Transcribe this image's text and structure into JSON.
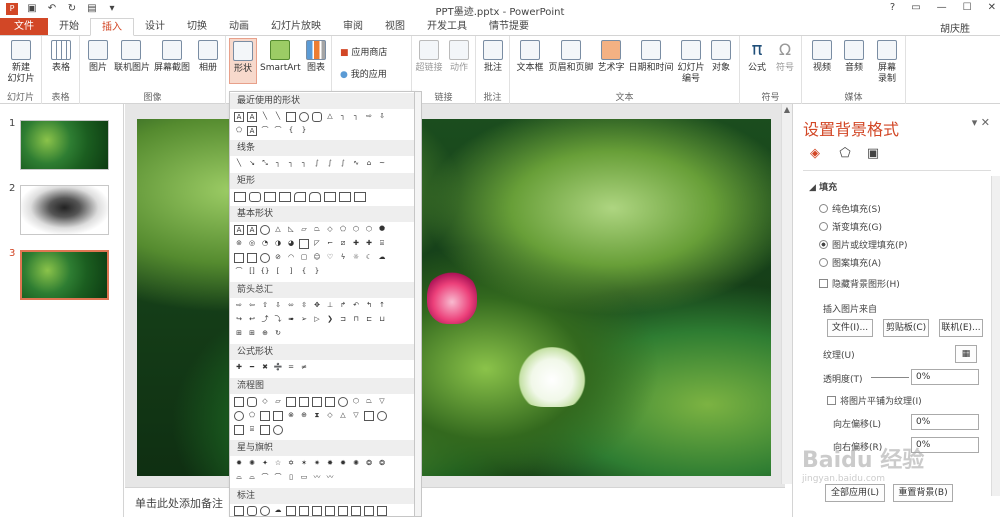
{
  "app": {
    "title": "PPT墨迹.pptx - PowerPoint",
    "user": "胡庆胜"
  },
  "tabs": [
    "文件",
    "开始",
    "插入",
    "设计",
    "切换",
    "动画",
    "幻灯片放映",
    "审阅",
    "视图",
    "开发工具",
    "情节提要"
  ],
  "ribbon": {
    "slides": {
      "label": "幻灯片",
      "new_slide": "新建\n幻灯片"
    },
    "tables": {
      "label": "表格",
      "table": "表格"
    },
    "images": {
      "label": "图像",
      "picture": "图片",
      "online_pictures": "联机图片",
      "screenshot": "屏幕截图",
      "album": "相册"
    },
    "illustrations": {
      "shapes": "形状",
      "smartart": "SmartArt",
      "chart": "图表"
    },
    "apps": {
      "store": "应用商店",
      "my_apps": "我的应用"
    },
    "links": {
      "label": "链接",
      "hyperlink": "超链接",
      "action": "动作"
    },
    "comments": {
      "label": "批注",
      "comment": "批注"
    },
    "text": {
      "label": "文本",
      "textbox": "文本框",
      "header_footer": "页眉和页脚",
      "wordart": "艺术字",
      "datetime": "日期和时间",
      "slide_number": "幻灯片\n编号",
      "object": "对象"
    },
    "symbols": {
      "label": "符号",
      "equation": "公式",
      "symbol": "符号"
    },
    "media": {
      "label": "媒体",
      "video": "视频",
      "audio": "音频",
      "screen_record": "屏幕\n录制"
    }
  },
  "thumbnails": [
    {
      "num": "1"
    },
    {
      "num": "2"
    },
    {
      "num": "3"
    }
  ],
  "notes_placeholder": "单击此处添加备注",
  "shapes_menu": {
    "sections": [
      "最近使用的形状",
      "线条",
      "矩形",
      "基本形状",
      "箭头总汇",
      "公式形状",
      "流程图",
      "星与旗帜",
      "标注"
    ]
  },
  "panel": {
    "title": "设置背景格式",
    "fill_header": "填充",
    "options": [
      "纯色填充(S)",
      "渐变填充(G)",
      "图片或纹理填充(P)",
      "图案填充(A)"
    ],
    "hide_bg": "隐藏背景图形(H)",
    "insert_from": "插入图片来自",
    "btn_file": "文件(I)...",
    "btn_clipboard": "剪贴板(C)",
    "btn_online": "联机(E)...",
    "texture": "纹理(U)",
    "transparency": "透明度(T)",
    "transparency_value": "0%",
    "tile": "将图片平铺为纹理(I)",
    "offset_left": "向左偏移(L)",
    "offset_left_value": "0%",
    "offset_right": "向右偏移(R)",
    "offset_right_value": "0%",
    "apply_all": "全部应用(L)",
    "reset": "重置背景(B)"
  },
  "watermark": {
    "main": "Baidu 经验",
    "sub": "jingyan.baidu.com"
  }
}
